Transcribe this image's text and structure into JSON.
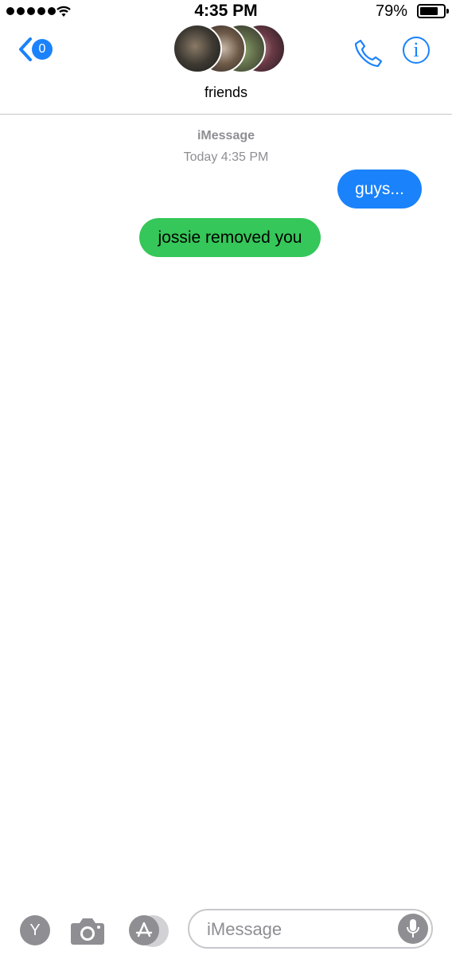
{
  "status_bar": {
    "time": "4:35 PM",
    "battery_percent": "79%",
    "battery_level": 0.79,
    "signal_icon": "signal-dots-icon",
    "wifi_icon": "wifi-icon"
  },
  "nav": {
    "back_badge": "0",
    "group_name": "friends",
    "back_icon": "chevron-left-icon",
    "call_icon": "phone-icon",
    "info_icon": "info-icon",
    "info_glyph": "i"
  },
  "conversation": {
    "service": "iMessage",
    "timestamp": "Today 4:35 PM",
    "messages": [
      {
        "text": "guys...",
        "direction": "sent",
        "color": "#1a82fb"
      },
      {
        "text": "jossie removed you",
        "direction": "received",
        "color": "#35c759"
      }
    ]
  },
  "toolbar": {
    "y_app_label": "Y",
    "camera_icon": "camera-icon",
    "app_store_icon": "app-store-icon",
    "input_placeholder": "iMessage",
    "mic_icon": "microphone-icon"
  },
  "colors": {
    "accent": "#1a82fb",
    "sent_bubble": "#1a82fb",
    "received_bubble": "#35c759",
    "secondary_text": "#8e8e93"
  }
}
